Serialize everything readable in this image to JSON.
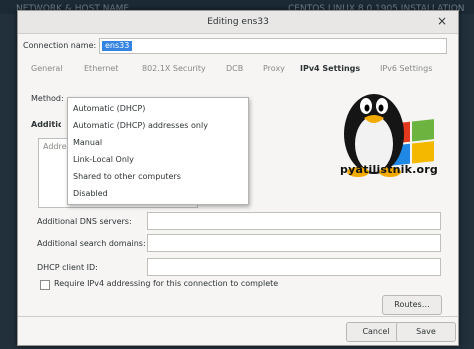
{
  "background": {
    "left_title": "NETWORK & HOST NAME",
    "right_title": "CENTOS LINUX 8.0.1905 INSTALLATION"
  },
  "dialog": {
    "title": "Editing ens33",
    "close_glyph": "×",
    "connection_name_label": "Connection name:",
    "connection_name_value": "ens33"
  },
  "tabs": [
    {
      "label": "General"
    },
    {
      "label": "Ethernet"
    },
    {
      "label": "802.1X Security"
    },
    {
      "label": "DCB"
    },
    {
      "label": "Proxy"
    },
    {
      "label": "IPv4 Settings",
      "active": true
    },
    {
      "label": "IPv6 Settings"
    }
  ],
  "ipv4": {
    "method_label": "Method:",
    "method_options": [
      "Automatic (DHCP)",
      "Automatic (DHCP) addresses only",
      "Manual",
      "Link-Local Only",
      "Shared to other computers",
      "Disabled"
    ],
    "additional_label_peek": "Additional",
    "address_header_peek": "Address",
    "dns_label": "Additional DNS servers:",
    "search_label": "Additional search domains:",
    "dhcp_label": "DHCP client ID:",
    "require_label": "Require IPv4 addressing for this connection to complete",
    "require_checked": false,
    "routes_button": "Routes…"
  },
  "footer": {
    "cancel": "Cancel",
    "save": "Save"
  },
  "watermark": {
    "text": "pyatilistnik.org",
    "icon": "tux-penguin-with-windows-flag-logo"
  },
  "colors": {
    "accent": "#3584e4",
    "background": "#22303c"
  }
}
